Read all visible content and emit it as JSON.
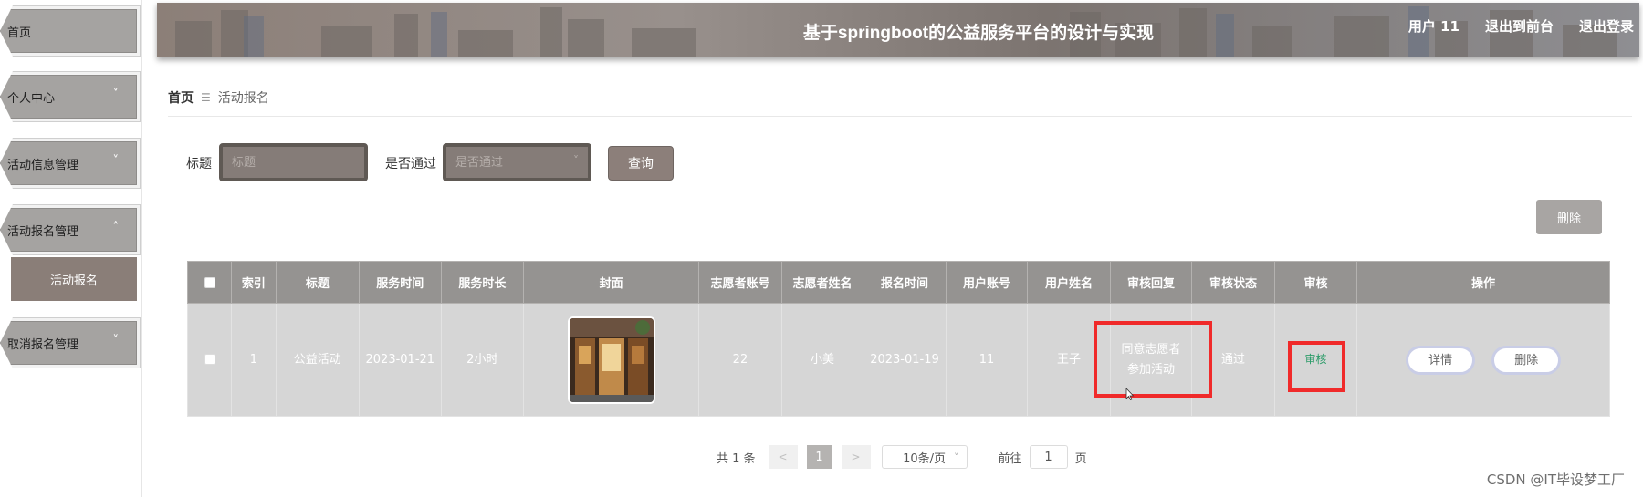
{
  "sidebar": {
    "items": [
      {
        "label": "首页",
        "chevron": ""
      },
      {
        "label": "个人中心",
        "chevron": "˅"
      },
      {
        "label": "活动信息管理",
        "chevron": "˅"
      },
      {
        "label": "活动报名管理",
        "chevron": "˄"
      },
      {
        "label": "取消报名管理",
        "chevron": "˅"
      }
    ],
    "sub_item": "活动报名"
  },
  "header": {
    "title": "基于springboot的公益服务平台的设计与实现",
    "user": "用户 11",
    "exit_front": "退出到前台",
    "logout": "退出登录"
  },
  "breadcrumb": {
    "home": "首页",
    "separator": "☰",
    "current": "活动报名"
  },
  "search": {
    "title_label": "标题",
    "title_placeholder": "标题",
    "passed_label": "是否通过",
    "passed_placeholder": "是否通过",
    "query_button": "查询"
  },
  "toolbar": {
    "delete_button": "删除"
  },
  "table": {
    "headers": [
      "索引",
      "标题",
      "服务时间",
      "服务时长",
      "封面",
      "志愿者账号",
      "志愿者姓名",
      "报名时间",
      "用户账号",
      "用户姓名",
      "审核回复",
      "审核状态",
      "审核",
      "操作"
    ],
    "rows": [
      {
        "index": "1",
        "title": "公益活动",
        "service_time": "2023-01-21",
        "duration": "2小时",
        "volunteer_account": "22",
        "volunteer_name": "小美",
        "signup_time": "2023-01-19",
        "user_account": "11",
        "user_name": "王子",
        "reply": "同意志愿者参加活动",
        "status": "通过",
        "audit_link": "审核",
        "detail_button": "详情",
        "delete_button": "删除"
      }
    ]
  },
  "pagination": {
    "total": "共 1 条",
    "prev": "<",
    "page": "1",
    "next": ">",
    "page_size": "10条/页",
    "goto_label": "前往",
    "goto_value": "1",
    "page_unit": "页"
  },
  "watermark": "CSDN @IT毕设梦工厂",
  "colors": {
    "header_bg": "#8c7f78",
    "table_header": "#959391",
    "table_row": "#d6d6d6",
    "highlight_red": "#f02a2a",
    "audit_green": "#2e9c6a"
  }
}
